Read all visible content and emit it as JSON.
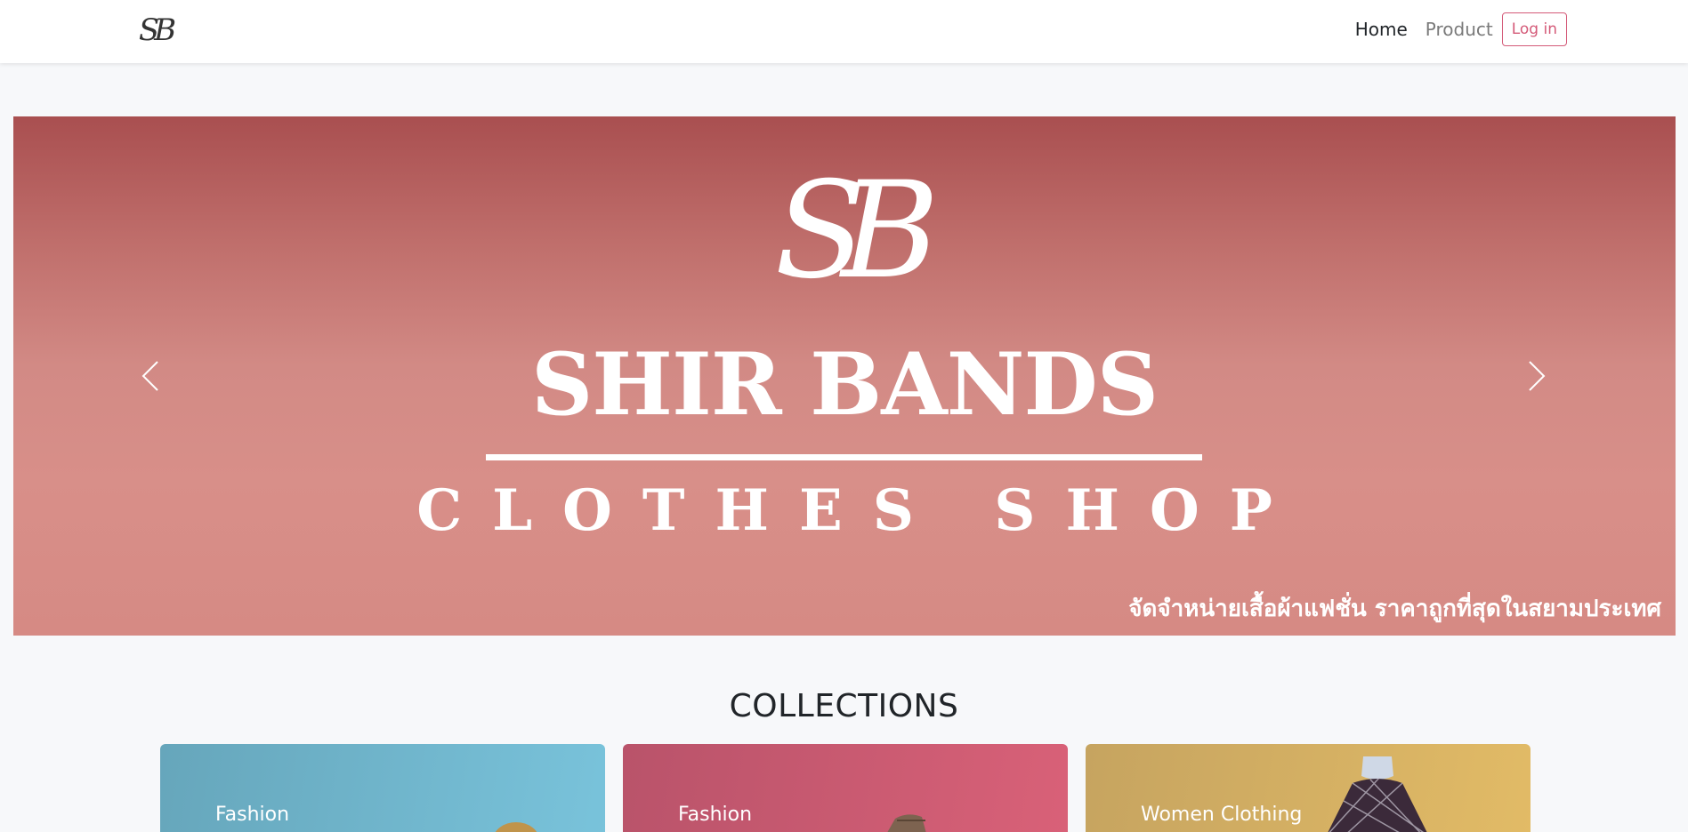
{
  "header": {
    "brand": "SB",
    "nav": [
      {
        "label": "Home",
        "active": true
      },
      {
        "label": "Product",
        "active": false
      }
    ],
    "login_label": "Log in"
  },
  "hero": {
    "logo": "SB",
    "title": "SHIR BANDS",
    "subtitle": "CLOTHES SHOP",
    "tagline": "จัดจำหน่ายเสื้อผ้าแฟชั่น ราคาถูกที่สุดในสยามประเทศ",
    "prev_icon": "chevron-left-icon",
    "next_icon": "chevron-right-icon"
  },
  "collections": {
    "title": "COLLECTIONS",
    "cards": [
      {
        "label": "Fashion",
        "color": "#6fb3c9"
      },
      {
        "label": "Fashion",
        "color": "#cd5a70"
      },
      {
        "label": "Women Clothing",
        "color": "#d4b063"
      }
    ]
  },
  "colors": {
    "accent": "#d45a78",
    "banner": "#c97570"
  }
}
